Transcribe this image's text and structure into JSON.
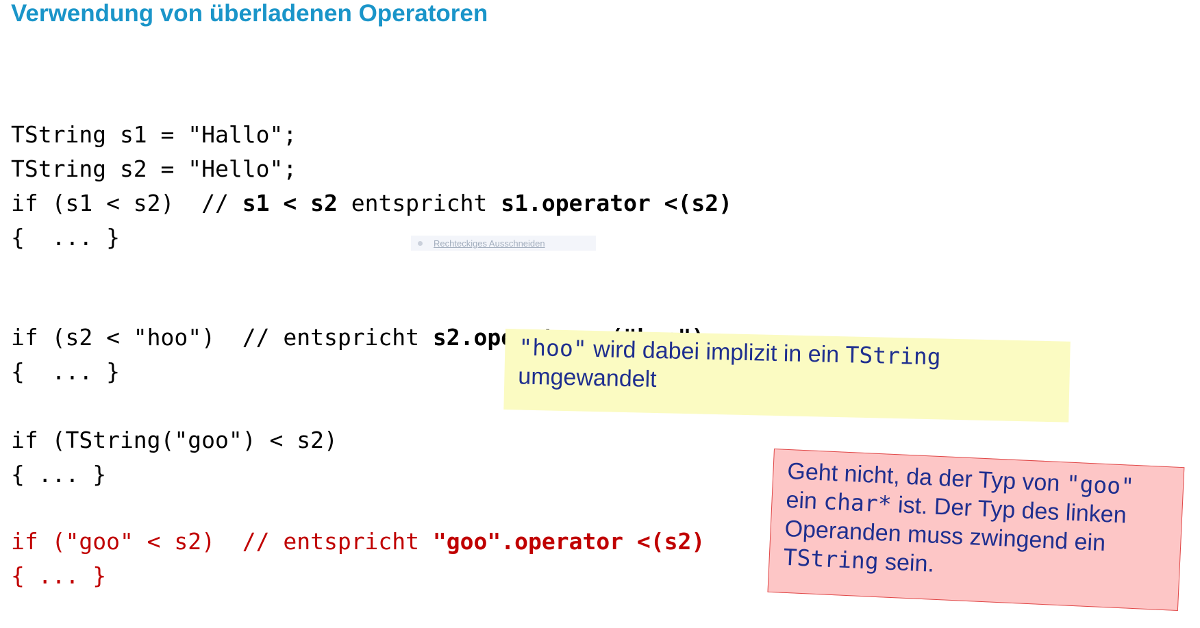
{
  "title": "Verwendung von überladenen Operatoren",
  "snip_overlay": {
    "label": "Rechteckiges Ausschneiden"
  },
  "code": {
    "block1": {
      "line1": "TString s1 = \"Hallo\";",
      "line2": "TString s2 = \"Hello\";",
      "line3_plain": "if (s1 < s2)  // ",
      "line3_bold1": "s1 < s2",
      "line3_mid": " entspricht ",
      "line3_bold2": "s1.operator <(s2)",
      "line4": "{  ... }"
    },
    "block2": {
      "line1_plain": "if (s2 < \"hoo\")  // entspricht ",
      "line1_bold": "s2.operator <(\"hoo\")",
      "line2": "{  ... }"
    },
    "block3": {
      "line1": "if (TString(\"goo\") < s2)",
      "line2": "{ ... }"
    },
    "block4": {
      "line1_plain": "if (\"goo\" < s2)  // entspricht ",
      "line1_bold": "\"goo\".operator <(s2)",
      "line2": "{ ... }"
    }
  },
  "notes": {
    "yellow": {
      "code_word": "\"hoo\"",
      "text1": " wird dabei implizit in ein ",
      "code_word2": "TString",
      "text2": "umgewandelt"
    },
    "red": {
      "line1_text": "Geht nicht, da der Typ von ",
      "line1_code": "\"goo\"",
      "line2_text1": "ein ",
      "line2_code": "char*",
      "line2_text2": " ist. Der Typ des linken",
      "line3_text": "Operanden muss zwingend ein",
      "line4_code": "TString",
      "line4_text": " sein."
    }
  },
  "colors": {
    "title": "#1a95c9",
    "code": "#000000",
    "error_code": "#c00000",
    "note_text": "#1f2f8f",
    "yellow_note_bg": "#fbfbc2",
    "red_note_bg": "#fdc6c6",
    "red_note_border": "#e04848"
  }
}
